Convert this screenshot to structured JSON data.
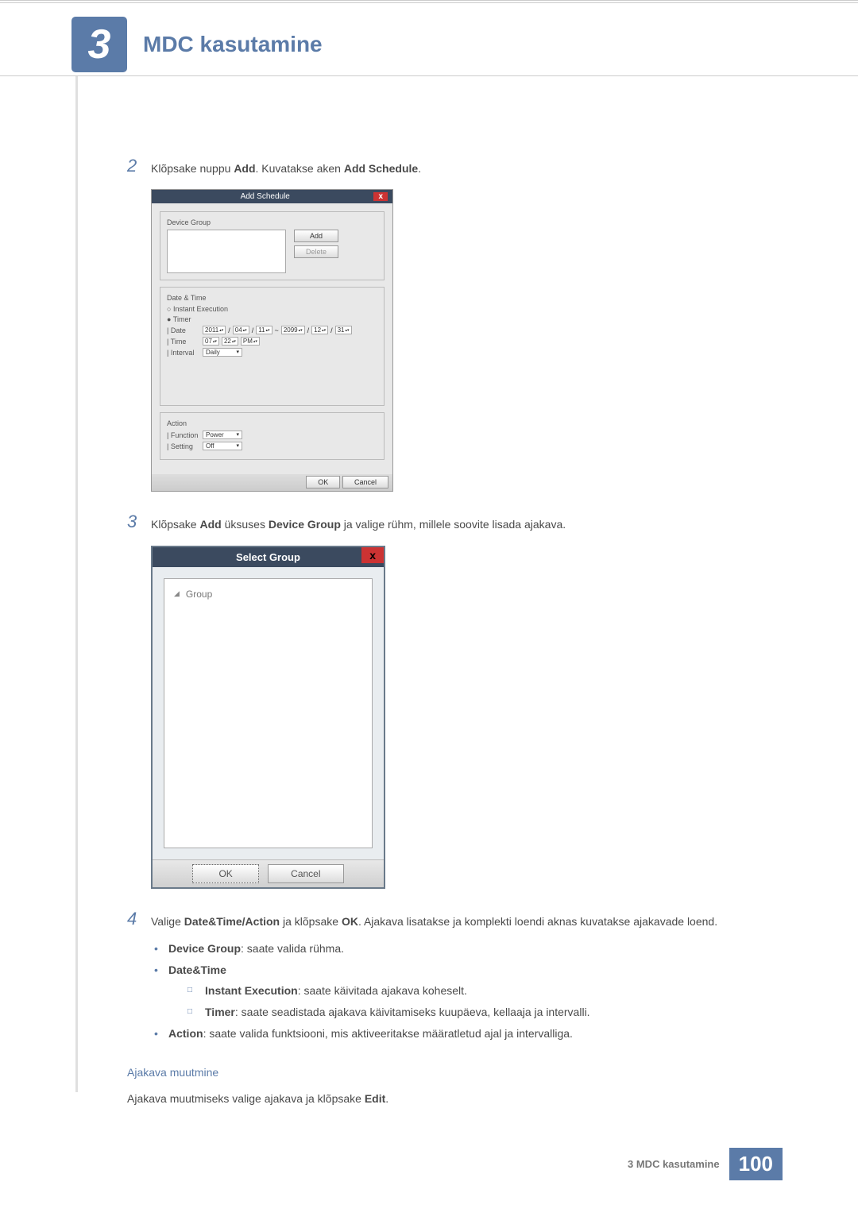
{
  "header": {
    "chapter_number": "3",
    "chapter_title": "MDC kasutamine"
  },
  "steps": {
    "s2": {
      "num": "2",
      "text_pre": "Klõpsake nuppu ",
      "bold1": "Add",
      "text_mid": ". Kuvatakse aken ",
      "bold2": "Add Schedule",
      "text_end": "."
    },
    "s3": {
      "num": "3",
      "text_pre": "Klõpsake ",
      "bold1": "Add",
      "text_mid": " üksuses ",
      "bold2": "Device Group",
      "text_end": " ja valige rühm, millele soovite lisada ajakava."
    },
    "s4": {
      "num": "4",
      "text_pre": "Valige ",
      "bold1": "Date&Time/Action",
      "text_mid": " ja klõpsake ",
      "bold2": "OK",
      "text_end": ". Ajakava lisatakse ja komplekti loendi aknas kuvatakse ajakavade loend."
    }
  },
  "dialog1": {
    "title": "Add Schedule",
    "section_device_group": "Device Group",
    "btn_add": "Add",
    "btn_delete": "Delete",
    "section_date_time": "Date & Time",
    "radio_instant": "Instant Execution",
    "radio_timer": "Timer",
    "label_date": "| Date",
    "date_y1": "2011",
    "date_m1": "04",
    "date_d1": "11",
    "date_tilde": "~",
    "date_y2": "2099",
    "date_m2": "12",
    "date_d2": "31",
    "label_time": "| Time",
    "time_h": "07",
    "time_m": "22",
    "time_ap": "PM",
    "label_interval": "| Interval",
    "interval_val": "Daily",
    "section_action": "Action",
    "label_function": "| Function",
    "function_val": "Power",
    "label_setting": "| Setting",
    "setting_val": "Off",
    "btn_ok": "OK",
    "btn_cancel": "Cancel"
  },
  "dialog2": {
    "title": "Select Group",
    "close": "x",
    "tree_root": "Group",
    "btn_ok": "OK",
    "btn_cancel": "Cancel"
  },
  "bullets": {
    "device_group_b": "Device Group",
    "device_group_t": ": saate valida rühma.",
    "date_time_b": "Date&Time",
    "instant_b": "Instant Execution",
    "instant_t": ": saate käivitada ajakava koheselt.",
    "timer_b": "Timer",
    "timer_t": ": saate seadistada ajakava käivitamiseks kuupäeva, kellaaja ja intervalli.",
    "action_b": "Action",
    "action_t": ": saate valida funktsiooni, mis aktiveeritakse määratletud ajal ja intervalliga."
  },
  "subsection": {
    "heading": "Ajakava muutmine",
    "para_pre": "Ajakava muutmiseks valige ajakava ja klõpsake ",
    "para_bold": "Edit",
    "para_end": "."
  },
  "footer": {
    "label": "3 MDC kasutamine",
    "page": "100"
  }
}
